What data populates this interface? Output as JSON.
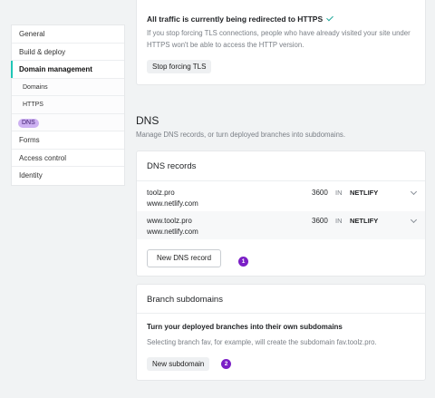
{
  "sidebar": {
    "items": [
      {
        "label": "General"
      },
      {
        "label": "Build & deploy"
      },
      {
        "label": "Domain management"
      },
      {
        "label": "Domains"
      },
      {
        "label": "HTTPS"
      },
      {
        "label": "DNS"
      },
      {
        "label": "Forms"
      },
      {
        "label": "Access control"
      },
      {
        "label": "Identity"
      }
    ]
  },
  "https_card": {
    "title": "All traffic is currently being redirected to HTTPS",
    "description": "If you stop forcing TLS connections, people who have already visited your site under HTTPS won't be able to access the HTTP version.",
    "button": "Stop forcing TLS"
  },
  "dns_section": {
    "title": "DNS",
    "subtitle": "Manage DNS records, or turn deployed branches into subdomains."
  },
  "dns_records": {
    "title": "DNS records",
    "records": [
      {
        "name": "toolz.pro",
        "value": "www.netlify.com",
        "ttl": "3600",
        "class": "IN",
        "type": "NETLIFY"
      },
      {
        "name": "www.toolz.pro",
        "value": "www.netlify.com",
        "ttl": "3600",
        "class": "IN",
        "type": "NETLIFY"
      }
    ],
    "button": "New DNS record",
    "badge": "1"
  },
  "branch_subdomains": {
    "title": "Branch subdomains",
    "heading": "Turn your deployed branches into their own subdomains",
    "description": "Selecting branch fav, for example, will create the subdomain fav.toolz.pro.",
    "button": "New subdomain",
    "badge": "2"
  },
  "colors": {
    "accent": "#20c6b7",
    "badge": "#7b1fc6",
    "check": "#20a79a"
  }
}
